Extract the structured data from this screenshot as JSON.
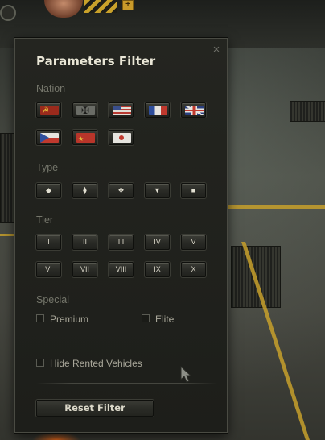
{
  "dialog": {
    "title": "Parameters Filter",
    "close_icon": "×"
  },
  "nation": {
    "label": "Nation",
    "items": [
      {
        "name": "ussr",
        "icon": "flag-ussr"
      },
      {
        "name": "germany",
        "icon": "flag-germany"
      },
      {
        "name": "usa",
        "icon": "flag-usa"
      },
      {
        "name": "france",
        "icon": "flag-france"
      },
      {
        "name": "uk",
        "icon": "flag-uk"
      },
      {
        "name": "czech",
        "icon": "flag-czech"
      },
      {
        "name": "china",
        "icon": "flag-china"
      },
      {
        "name": "japan",
        "icon": "flag-japan"
      }
    ]
  },
  "type": {
    "label": "Type",
    "items": [
      {
        "name": "light-tank",
        "glyph": "◆"
      },
      {
        "name": "medium-tank",
        "glyph": "⧫"
      },
      {
        "name": "heavy-tank",
        "glyph": "❖"
      },
      {
        "name": "tank-destroyer",
        "glyph": "▼"
      },
      {
        "name": "spg",
        "glyph": "■"
      }
    ]
  },
  "tier": {
    "label": "Tier",
    "items": [
      "I",
      "II",
      "III",
      "IV",
      "V",
      "VI",
      "VII",
      "VIII",
      "IX",
      "X"
    ]
  },
  "special": {
    "label": "Special",
    "premium": "Premium",
    "elite": "Elite"
  },
  "hide_rented": "Hide Rented Vehicles",
  "reset_button": "Reset Filter",
  "colors": {
    "accent_gold": "#c9a12a",
    "panel_bg": "#1f201c",
    "title_text": "#e9e6d6",
    "label_text": "#75766b"
  }
}
